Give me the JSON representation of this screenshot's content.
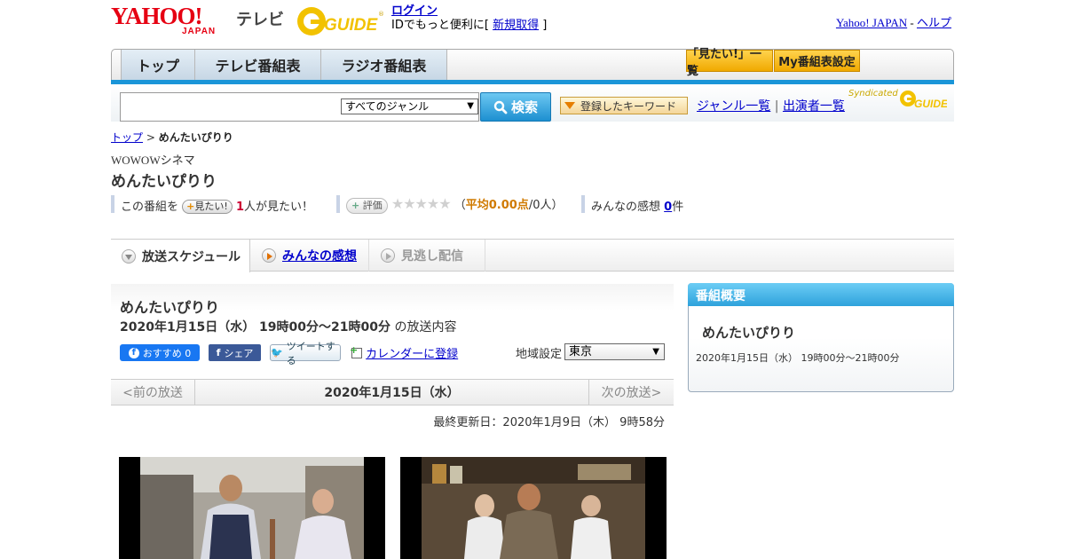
{
  "header": {
    "yahoo_logo": "YAHOO!",
    "yahoo_japan": "JAPAN",
    "tv_label": "テレビ",
    "gguide_logo": "GUIDE",
    "login_link": "ログイン",
    "login_prompt": "IDでもっと便利に[",
    "signup_link": "新規取得",
    "signup_close": "]",
    "yahoo_japan_link": "Yahoo! JAPAN",
    "separator": " - ",
    "help_link": "ヘルプ"
  },
  "nav": {
    "tabs": [
      "トップ",
      "テレビ番組表",
      "ラジオ番組表"
    ],
    "watchlist_button": "「見たい!」一覧",
    "my_schedule_button": "My番組表設定"
  },
  "search": {
    "input_value": "",
    "genre_selected": "すべてのジャンル",
    "search_button": "検索",
    "keyword_button": "登録したキーワード",
    "genre_list_link": "ジャンル一覧",
    "divider": "|",
    "performer_list_link": "出演者一覧",
    "syndicated": "Syndicated"
  },
  "breadcrumb": {
    "top": "トップ",
    "sep": ">",
    "current": "めんたいぴりり"
  },
  "program": {
    "channel": "WOWOWシネマ",
    "title": "めんたいぴりり",
    "stats_prefix": "この番組を",
    "mitai_pill": "見たい!",
    "mitai_count": "1",
    "mitai_suffix": "人が見たい！",
    "eval_pill": "評価",
    "stars": "★★★★★",
    "avg_open": "（",
    "avg_label": "平均0.00点",
    "avg_count": "/0人）",
    "impressions_label": "みんなの感想",
    "impressions_count": "0",
    "impressions_suffix": "件"
  },
  "tabs": [
    {
      "label": "放送スケジュール"
    },
    {
      "label": "みんなの感想"
    },
    {
      "label": "見逃し配信"
    }
  ],
  "schedule": {
    "title": "めんたいぴりり",
    "datetime": "2020年1月15日（水） 19時00分～21時00分",
    "datetime_suffix": "の放送内容",
    "fb_button": "おすすめ 0",
    "share_button": "シェア",
    "tweet_button": "ツイートする",
    "calendar_link": "カレンダーに登録",
    "region_label": "地域設定",
    "region_selected": "東京",
    "prev": "<前の放送",
    "current_date": "2020年1月15日（水）",
    "next": "次の放送>",
    "updated": "最終更新日：2020年1月9日（木） 9時58分"
  },
  "summary": {
    "heading": "番組概要",
    "title": "めんたいぴりり",
    "time": "2020年1月15日（水） 19時00分～21時00分"
  },
  "colors": {
    "brand_red": "#e60012",
    "accent_blue": "#1a95d8",
    "link": "#0000cc",
    "highlight_orange": "#d07a00"
  }
}
